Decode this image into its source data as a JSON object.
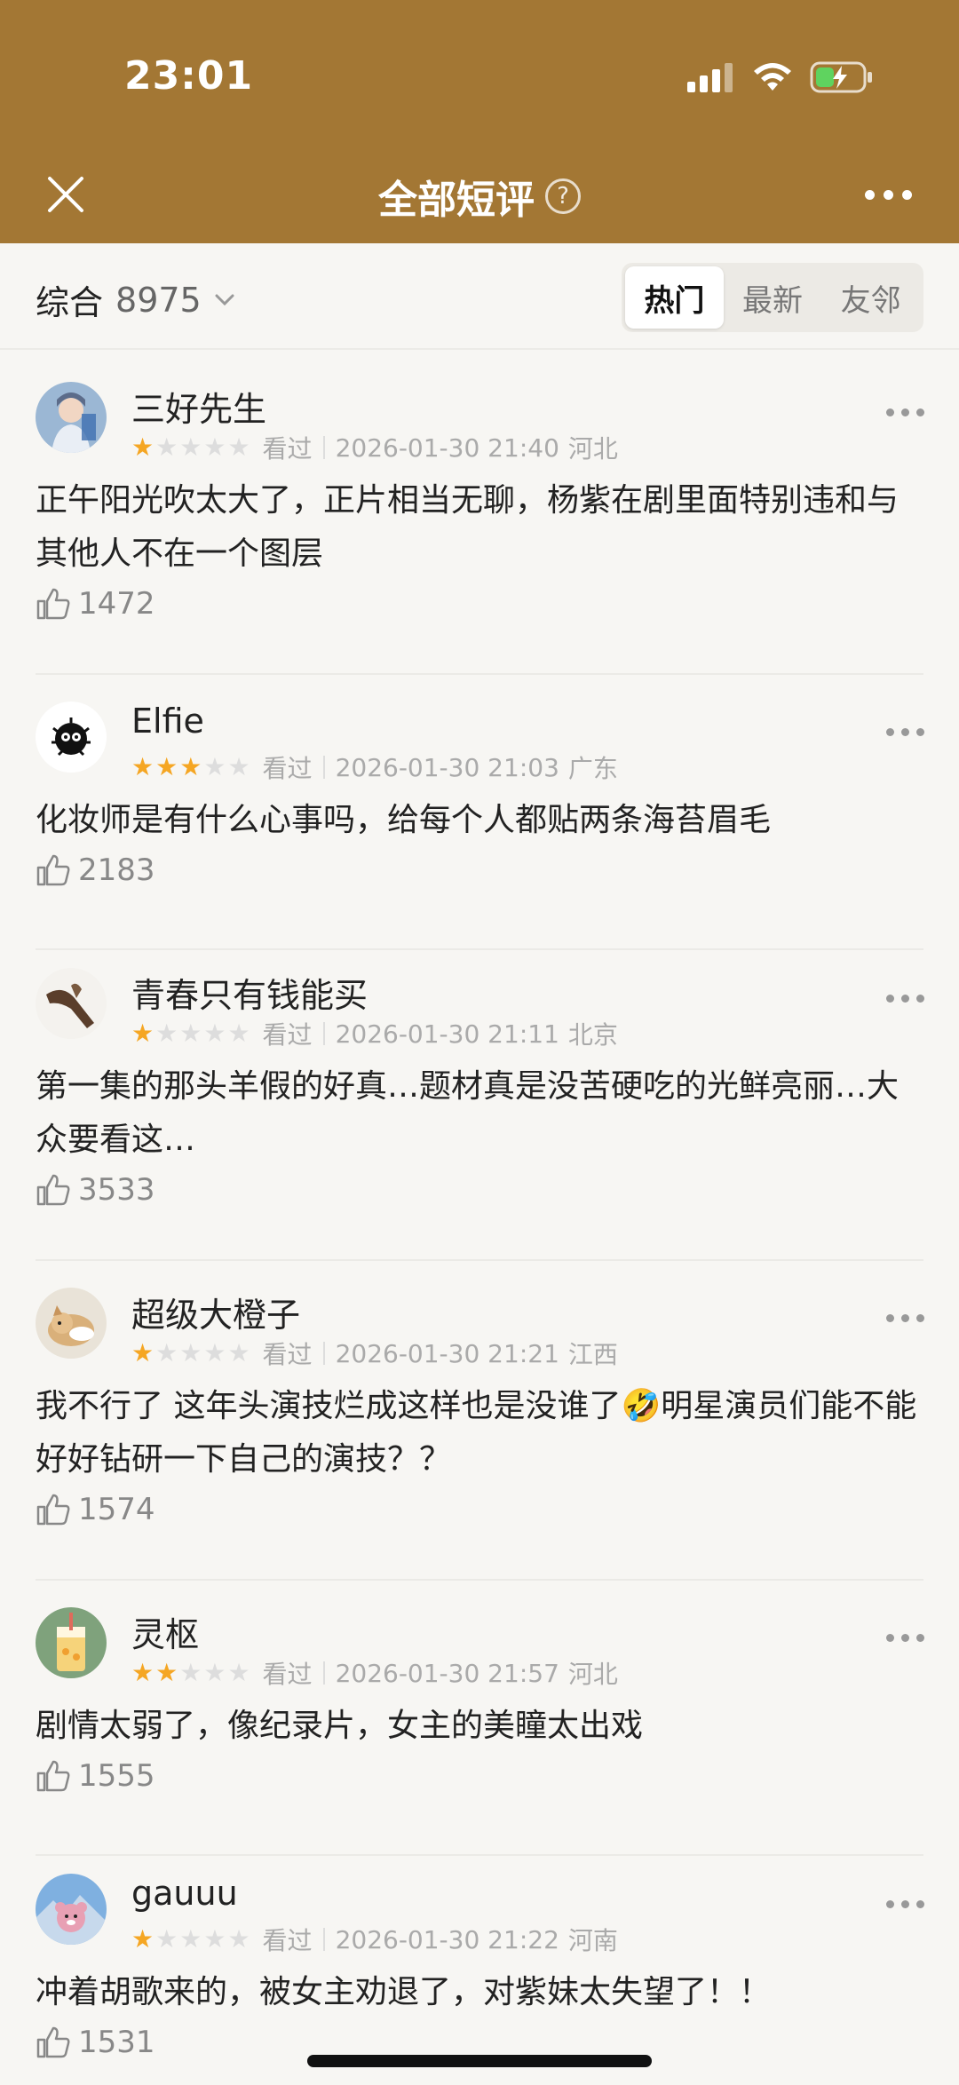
{
  "status": {
    "time": "23:01"
  },
  "nav": {
    "title": "全部短评",
    "help": "?"
  },
  "filter": {
    "sort_label": "综合",
    "sort_count": "8975",
    "tabs": [
      {
        "label": "热门",
        "active": true
      },
      {
        "label": "最新",
        "active": false
      },
      {
        "label": "友邻",
        "active": false
      }
    ]
  },
  "colors": {
    "header": "#a37734",
    "star": "#f5a623"
  },
  "reviews": [
    {
      "user": "三好先生",
      "rating": 1,
      "watched": "看过",
      "date": "2026-01-30 21:40",
      "location": "河北",
      "text": "正午阳光吹太大了，正片相当无聊，杨紫在剧里面特别违和与其他人不在一个图层",
      "likes": "1472",
      "avatar": "avatar-costume"
    },
    {
      "user": "Elfie",
      "rating": 3,
      "watched": "看过",
      "date": "2026-01-30 21:03",
      "location": "广东",
      "text": "化妆师是有什么心事吗，给每个人都贴两条海苔眉毛",
      "likes": "2183",
      "avatar": "avatar-soot-sprite"
    },
    {
      "user": "青春只有钱能买",
      "rating": 1,
      "watched": "看过",
      "date": "2026-01-30 21:11",
      "location": "北京",
      "text": "第一集的那头羊假的好真…题材真是没苦硬吃的光鲜亮丽…大众要看这…",
      "likes": "3533",
      "avatar": "avatar-hand"
    },
    {
      "user": "超级大橙子",
      "rating": 1,
      "watched": "看过",
      "date": "2026-01-30 21:21",
      "location": "江西",
      "text": "我不行了 这年头演技烂成这样也是没谁了🤣明星演员们能不能好好钻研一下自己的演技？？",
      "likes": "1574",
      "avatar": "avatar-cat"
    },
    {
      "user": "灵枢",
      "rating": 2,
      "watched": "看过",
      "date": "2026-01-30 21:57",
      "location": "河北",
      "text": "剧情太弱了，像纪录片，女主的美瞳太出戏",
      "likes": "1555",
      "avatar": "avatar-drink"
    },
    {
      "user": "gauuu",
      "rating": 1,
      "watched": "看过",
      "date": "2026-01-30 21:22",
      "location": "河南",
      "text": "冲着胡歌来的，被女主劝退了，对紫妹太失望了！！",
      "likes": "1531",
      "avatar": "avatar-bear"
    }
  ]
}
